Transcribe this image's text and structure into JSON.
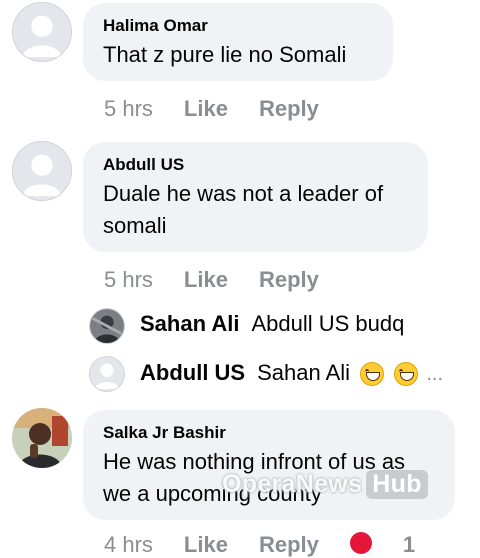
{
  "comments": [
    {
      "author": "Halima Omar",
      "text": "That z pure lie no Somali",
      "time": "5 hrs",
      "like": "Like",
      "reply": "Reply"
    },
    {
      "author": "Abdull US",
      "text_line1": "Duale he was not a leader of",
      "text_line2": "somali",
      "time": "5 hrs",
      "like": "Like",
      "reply": "Reply"
    },
    {
      "author": "Salka Jr Bashir",
      "text_line1": "He was nothing infront of us as",
      "text_line2": "we a upcoming county",
      "time": "4 hrs",
      "like": "Like",
      "reply": "Reply",
      "reaction_count": "1"
    }
  ],
  "replies": [
    {
      "author": "Sahan Ali",
      "text": "Abdull US budq"
    },
    {
      "author": "Abdull US",
      "text": "Sahan Ali",
      "emojis": [
        "grinning-squinting-face",
        "grinning-squinting-face"
      ],
      "ellipsis": "..."
    }
  ],
  "watermark": {
    "text": "OperaNews",
    "badge": "Hub"
  }
}
